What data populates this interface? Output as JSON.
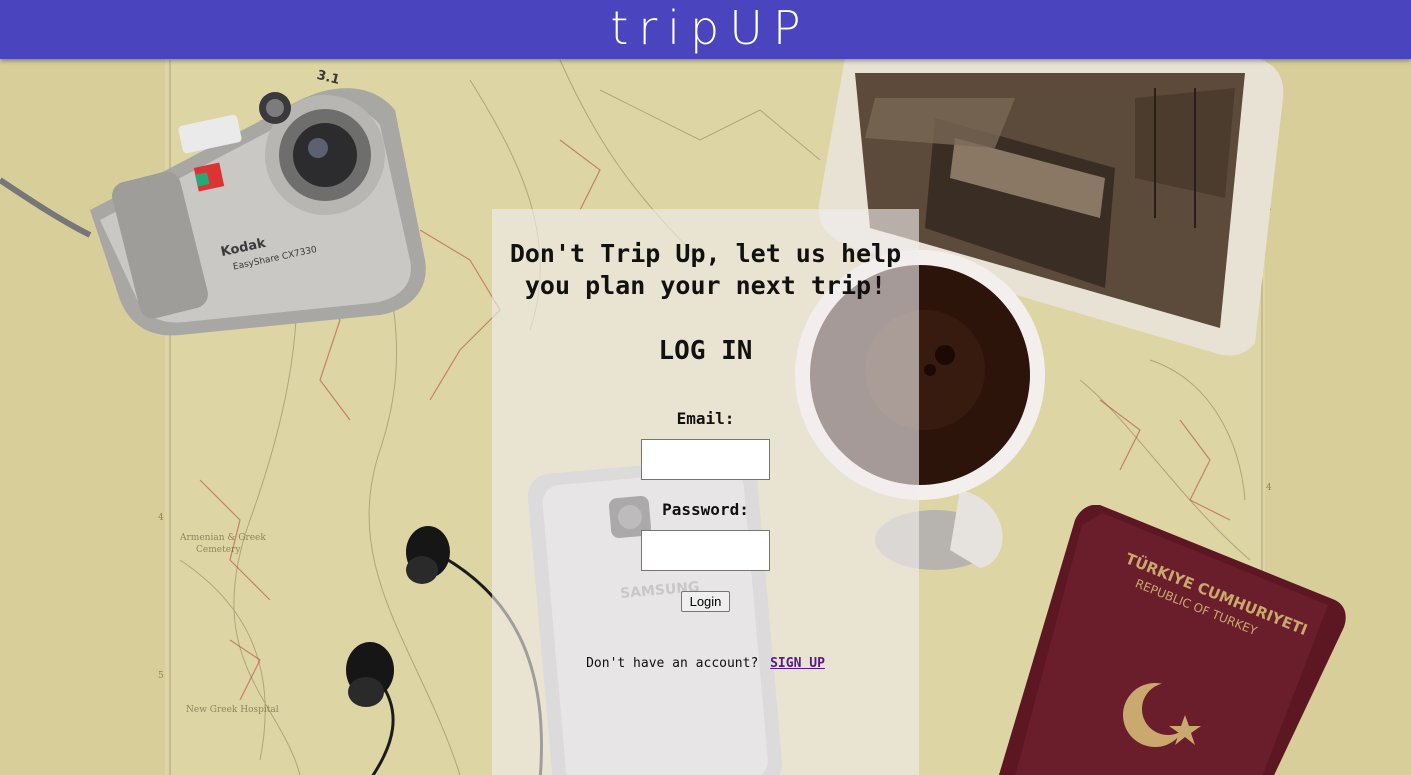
{
  "header": {
    "brand": "tripUP",
    "color": "#4a44bf"
  },
  "login_panel": {
    "tagline_line1": "Don't Trip Up, let us help",
    "tagline_line2": "you plan your next trip!",
    "heading": "LOG IN",
    "email_label": "Email:",
    "email_value": "",
    "password_label": "Password:",
    "password_value": "",
    "login_button": "Login",
    "signup_prompt": "Don't have an account?",
    "signup_link": "SIGN UP"
  },
  "background": {
    "camera_brand": "Kodak",
    "camera_model": "EasyShare CX7330",
    "camera_badge": "3.1",
    "phone_brand": "SAMSUNG",
    "passport_line1": "TÜRKIYE CUMHURIYETI",
    "passport_line2": "REPUBLIC OF TURKEY",
    "colors": {
      "map_paper": "#d9cf9c",
      "passport": "#5a1722",
      "coffee": "#2a140c"
    }
  }
}
